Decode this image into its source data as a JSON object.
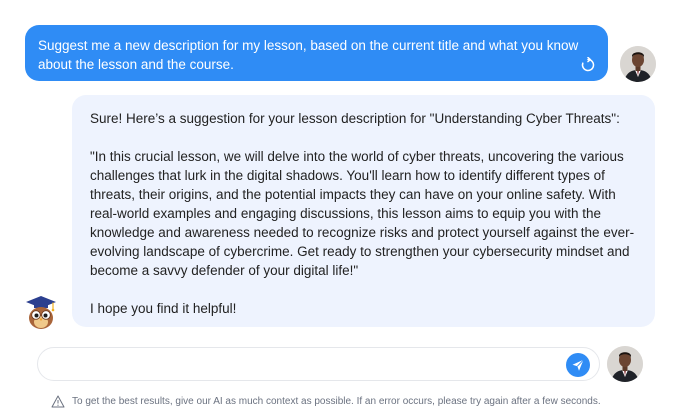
{
  "conversation": {
    "user_message": {
      "text": "Suggest me a new description for my lesson, based on the current title and what you know\nabout the lesson and the course."
    },
    "ai_message": {
      "intro": "Sure! Here’s a suggestion for your lesson description for \"Understanding Cyber Threats\":",
      "body": "\"In this crucial lesson, we will delve into the world of cyber threats, uncovering the various challenges that lurk in the digital shadows. You'll learn how to identify different types of threats, their origins, and the potential impacts they can have on your online safety. With real-world examples and engaging discussions, this lesson aims to equip you with the knowledge and awareness needed to recognize risks and protect yourself against the ever-evolving landscape of cybercrime. Get ready to strengthen your cybersecurity mindset and become a savvy defender of your digital life!\"",
      "closing": "I hope you find it helpful!"
    }
  },
  "composer": {
    "value": "",
    "placeholder": ""
  },
  "footer": {
    "note": "To get the best results, give our AI as much context as possible. If an error occurs, please try again after a few seconds."
  },
  "icons": {
    "regenerate": "regenerate-icon",
    "send": "send-icon",
    "warning": "warning-icon",
    "ai_avatar": "owl-mascot-icon",
    "user_avatar": "user-avatar"
  },
  "colors": {
    "accent": "#2f8cf5",
    "ai_bubble": "#eef3fe",
    "user_text": "#ffffff"
  }
}
